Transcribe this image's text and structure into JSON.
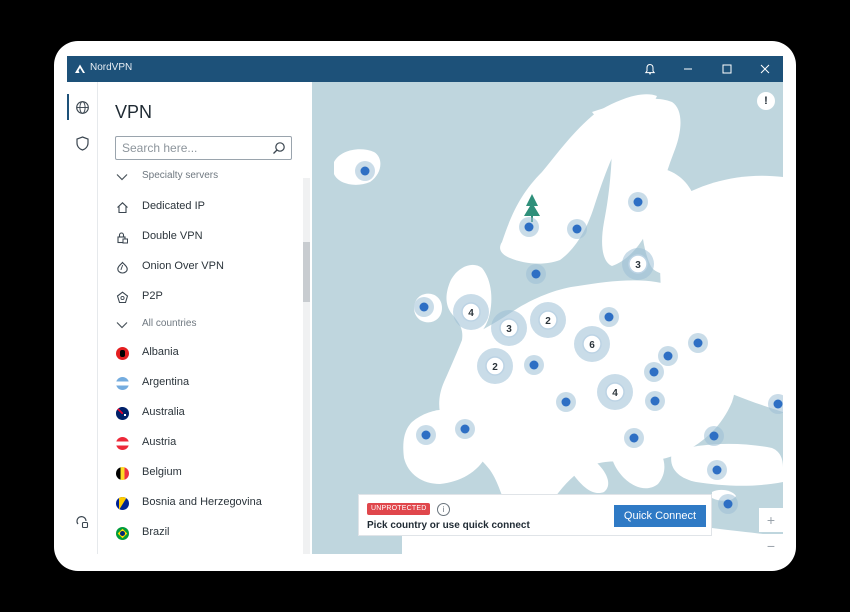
{
  "app": {
    "title": "NordVPN"
  },
  "panel": {
    "title": "VPN",
    "search_placeholder": "Search here...",
    "sections": {
      "specialty": "Specialty servers",
      "all_countries": "All countries"
    },
    "specialty_items": [
      {
        "label": "Dedicated IP",
        "icon": "home-icon"
      },
      {
        "label": "Double VPN",
        "icon": "double-lock-icon"
      },
      {
        "label": "Onion Over VPN",
        "icon": "onion-icon"
      },
      {
        "label": "P2P",
        "icon": "p2p-icon"
      }
    ],
    "countries": [
      {
        "label": "Albania",
        "flag": [
          "#e41e20",
          "#000000"
        ]
      },
      {
        "label": "Argentina",
        "flag": [
          "#74acdf",
          "#ffffff"
        ]
      },
      {
        "label": "Australia",
        "flag": [
          "#012169",
          "#e4002b"
        ]
      },
      {
        "label": "Austria",
        "flag": [
          "#ed2939",
          "#ffffff"
        ]
      },
      {
        "label": "Belgium",
        "flag": [
          "#000000",
          "#fdda24",
          "#ef3340"
        ]
      },
      {
        "label": "Bosnia and Herzegovina",
        "flag": [
          "#002395",
          "#fecb00"
        ]
      },
      {
        "label": "Brazil",
        "flag": [
          "#009c3b",
          "#ffdf00"
        ]
      }
    ]
  },
  "status": {
    "badge": "UNPROTECTED",
    "message": "Pick country or use quick connect",
    "quick_connect": "Quick Connect"
  },
  "map": {
    "cluster_counts": [
      "4",
      "3",
      "2",
      "2",
      "6",
      "4",
      "3"
    ],
    "zoom_in": "+",
    "zoom_out": "−",
    "alert": "!"
  },
  "colors": {
    "titlebar": "#1d5179",
    "map_water": "#bfd6de",
    "map_land": "#ffffff",
    "pin": "#2e6fc4",
    "unprotected": "#e0474c",
    "accent": "#2f7ac5"
  }
}
